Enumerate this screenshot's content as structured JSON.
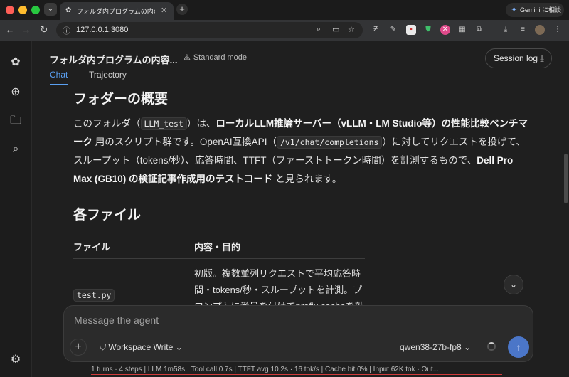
{
  "browser": {
    "tab_title": "フォルダ内プログラムの内容と目",
    "tab_close": "✕",
    "new_tab": "+",
    "url": "127.0.0.1:3080",
    "gemini_label": "Gemini に相談"
  },
  "header": {
    "conversation_title": "フォルダ内プログラムの内容...",
    "mode_label": "Standard mode",
    "tabs": [
      {
        "label": "Chat",
        "active": true
      },
      {
        "label": "Trajectory",
        "active": false
      }
    ],
    "session_log_label": "Session log"
  },
  "content": {
    "section1_title": "フォダーの概要",
    "p1_a": "このフォルダ（",
    "p1_code1": "LLM_test",
    "p1_b": "）は、",
    "p1_bold1": "ローカルLLM推論サーバー（vLLM・LM Studio等）の性能比較ベンチマーク",
    "p1_c": " 用のスクリプト群です。OpenAI互換API（",
    "p1_code2": "/v1/chat/completions",
    "p1_d": "）に対してリクエストを投げて、スループット（tokens/秒）、応答時間、TTFT（ファーストトークン時間）を計測するもので、",
    "p1_bold2": "Dell Pro Max (GB10) の検証記事作成用のテストコード",
    "p1_e": " と見られます。",
    "section2_title": "各ファイル",
    "table": {
      "headers": [
        "ファイル",
        "内容・目的"
      ],
      "rows": [
        {
          "file": "test.py",
          "desc": "初版。複数並列リクエストで平均応答時間・tokens/秒・スループットを計測。プロンプトに番号を付けてprefix cacheを効"
        }
      ]
    }
  },
  "composer": {
    "placeholder": "Message the agent",
    "workspace_label": "Workspace Write",
    "model_label": "qwen38-27b-fp8"
  },
  "status_bar": "1 turns · 4 steps   |   LLM 1m58s · Tool call 0.7s   |   TTFT avg 10.2s · 16 tok/s   |   Cache hit 0%   |   Input 62K tok · Out..."
}
